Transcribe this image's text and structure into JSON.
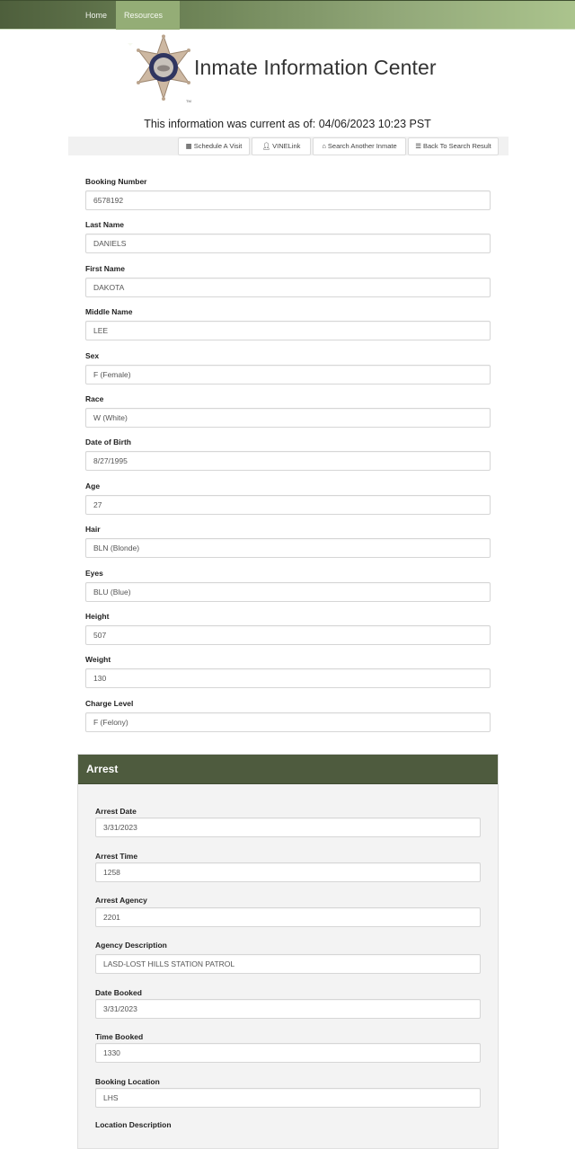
{
  "nav": {
    "home": "Home",
    "resources": "Resources"
  },
  "header": {
    "title": "Inmate Information Center",
    "badge_alt": "Sheriff star badge"
  },
  "current_as_of": "This information was current as of: 04/06/2023 10:23 PST",
  "toolbar": {
    "schedule_visit": "Schedule A Visit",
    "vinelink": "VINELink",
    "search_another": "Search Another Inmate",
    "back_to_results": "Back To Search Result"
  },
  "inmate": {
    "fields": [
      {
        "label": "Booking Number",
        "value": "6578192"
      },
      {
        "label": "Last Name",
        "value": "DANIELS"
      },
      {
        "label": "First Name",
        "value": "DAKOTA"
      },
      {
        "label": "Middle Name",
        "value": "LEE"
      },
      {
        "label": "Sex",
        "value": "F (Female)"
      },
      {
        "label": "Race",
        "value": "W (White)"
      },
      {
        "label": "Date of Birth",
        "value": "8/27/1995"
      },
      {
        "label": "Age",
        "value": "27"
      },
      {
        "label": "Hair",
        "value": "BLN (Blonde)"
      },
      {
        "label": "Eyes",
        "value": "BLU (Blue)"
      },
      {
        "label": "Height",
        "value": "507"
      },
      {
        "label": "Weight",
        "value": "130"
      },
      {
        "label": "Charge Level",
        "value": "F (Felony)"
      }
    ]
  },
  "arrest": {
    "title": "Arrest",
    "fields": [
      {
        "label": "Arrest Date",
        "value": "3/31/2023"
      },
      {
        "label": "Arrest Time",
        "value": "1258"
      },
      {
        "label": "Arrest Agency",
        "value": "2201"
      },
      {
        "label": "Agency Description",
        "value": "LASD-LOST HILLS STATION PATROL"
      },
      {
        "label": "Date Booked",
        "value": "3/31/2023"
      },
      {
        "label": "Time Booked",
        "value": "1330"
      },
      {
        "label": "Booking Location",
        "value": "LHS"
      },
      {
        "label": "Location Description",
        "value": ""
      }
    ]
  },
  "colors": {
    "nav_dark": "#4e5f3c",
    "nav_light": "#abc48d",
    "nav_active": "#94ad76",
    "panel_header": "#4e5b3e"
  }
}
